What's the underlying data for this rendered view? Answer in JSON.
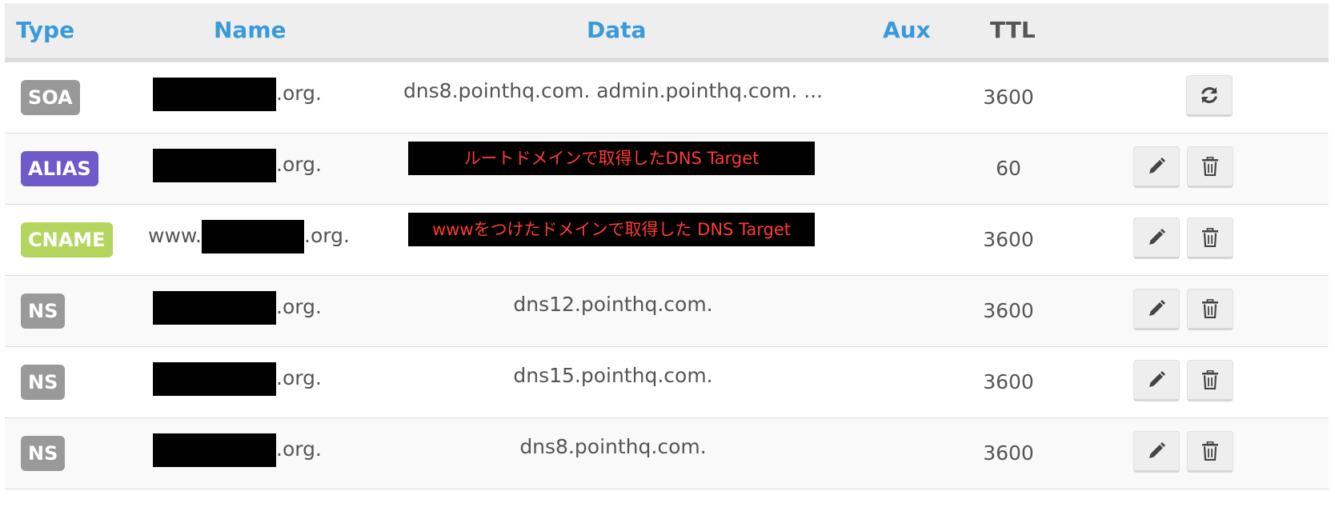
{
  "columns": {
    "type": "Type",
    "name": "Name",
    "data": "Data",
    "aux": "Aux",
    "ttl": "TTL"
  },
  "colors": {
    "header_link": "#3a9ad9",
    "soa": "#999999",
    "alias": "#6f5ac9",
    "cname": "#b4d65e",
    "ns": "#999999",
    "annotation": "#ff3b30"
  },
  "records": [
    {
      "type": "SOA",
      "name_prefix": "",
      "name_suffix": ".org.",
      "data": "dns8.pointhq.com. admin.pointhq.com. ...",
      "ttl": "3600",
      "actions": [
        "refresh-icon"
      ]
    },
    {
      "type": "ALIAS",
      "name_prefix": "",
      "name_suffix": ".org.",
      "data": "ルートドメインで取得したDNS Target",
      "ttl": "60",
      "actions": [
        "pencil-icon",
        "trash-icon"
      ]
    },
    {
      "type": "CNAME",
      "name_prefix": "www.",
      "name_suffix": ".org.",
      "data": "wwwをつけたドメインで取得した DNS Target",
      "ttl": "3600",
      "actions": [
        "pencil-icon",
        "trash-icon"
      ]
    },
    {
      "type": "NS",
      "name_prefix": "",
      "name_suffix": ".org.",
      "data": "dns12.pointhq.com.",
      "ttl": "3600",
      "actions": [
        "pencil-icon",
        "trash-icon"
      ]
    },
    {
      "type": "NS",
      "name_prefix": "",
      "name_suffix": ".org.",
      "data": "dns15.pointhq.com.",
      "ttl": "3600",
      "actions": [
        "pencil-icon",
        "trash-icon"
      ]
    },
    {
      "type": "NS",
      "name_prefix": "",
      "name_suffix": ".org.",
      "data": "dns8.pointhq.com.",
      "ttl": "3600",
      "actions": [
        "pencil-icon",
        "trash-icon"
      ]
    }
  ]
}
